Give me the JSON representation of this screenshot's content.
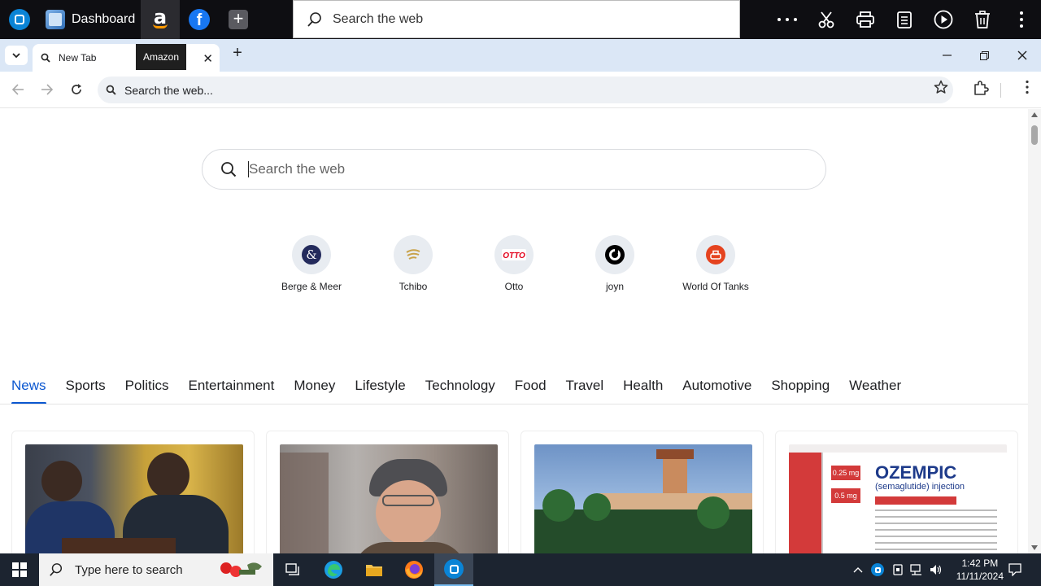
{
  "topbar": {
    "dashboard_label": "Dashboard",
    "search_placeholder": "Search the web"
  },
  "tabs": {
    "active_label": "New Tab",
    "tooltip": "Amazon"
  },
  "address_bar": {
    "placeholder": "Search the web..."
  },
  "page": {
    "search_placeholder": "Search the web",
    "shortcuts": [
      {
        "label": "Berge & Meer",
        "icon": "berge-meer-icon"
      },
      {
        "label": "Tchibo",
        "icon": "tchibo-icon"
      },
      {
        "label": "Otto",
        "icon": "otto-icon"
      },
      {
        "label": "joyn",
        "icon": "joyn-icon"
      },
      {
        "label": "World Of Tanks",
        "icon": "world-of-tanks-icon"
      }
    ],
    "categories": [
      "News",
      "Sports",
      "Politics",
      "Entertainment",
      "Money",
      "Lifestyle",
      "Technology",
      "Food",
      "Travel",
      "Health",
      "Automotive",
      "Shopping",
      "Weather"
    ],
    "active_category": "News",
    "ozempic_text": "OZEMPIC",
    "ozempic_sub": "(semaglutide) injection",
    "ozempic_dose1": "0.25 mg",
    "ozempic_dose2": "0.5 mg"
  },
  "taskbar": {
    "search_placeholder": "Type here to search",
    "time": "1:42 PM",
    "date": "11/11/2024"
  }
}
